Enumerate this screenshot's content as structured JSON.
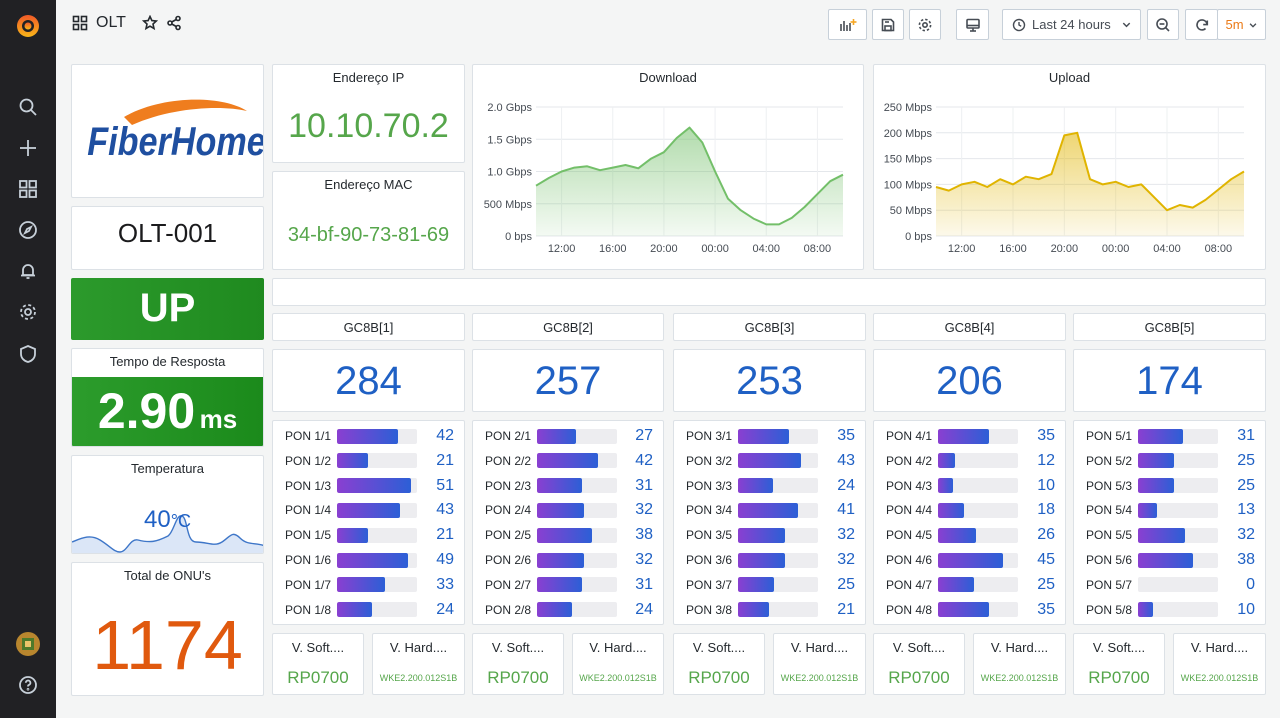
{
  "dashboard": {
    "title": "OLT"
  },
  "toolbar": {
    "time_range": "Last 24 hours",
    "refresh_interval": "5m"
  },
  "device": {
    "brand_logo_text": "FiberHome",
    "name": "OLT-001",
    "status": "UP",
    "ip_label": "Endereço IP",
    "ip": "10.10.70.2",
    "mac_label": "Endereço MAC",
    "mac": "34-bf-90-73-81-69",
    "response_label": "Tempo de Resposta",
    "response_value": "2.90",
    "response_unit": "ms",
    "temp_label": "Temperatura",
    "temp_value": "40",
    "temp_unit": "°C",
    "onu_label": "Total de ONU's",
    "onu_total": "1174"
  },
  "colors": {
    "up_green": "#299c29",
    "download_line": "#73bf69",
    "upload_line": "#e0b400",
    "onu_orange": "#e0590e",
    "value_blue": "#1f60c4"
  },
  "chart_data": [
    {
      "type": "area",
      "title": "Download",
      "x_ticks": [
        "12:00",
        "16:00",
        "20:00",
        "00:00",
        "04:00",
        "08:00"
      ],
      "y_ticks": [
        "0 bps",
        "500 Mbps",
        "1.0 Gbps",
        "1.5 Gbps",
        "2.0 Gbps"
      ],
      "ylim": [
        0,
        2000
      ],
      "unit": "Mbps",
      "x": [
        "10:00",
        "11:00",
        "12:00",
        "13:00",
        "14:00",
        "15:00",
        "16:00",
        "17:00",
        "18:00",
        "19:00",
        "20:00",
        "21:00",
        "22:00",
        "23:00",
        "00:00",
        "01:00",
        "02:00",
        "03:00",
        "04:00",
        "05:00",
        "06:00",
        "07:00",
        "08:00",
        "09:00",
        "10:00"
      ],
      "values": [
        780,
        900,
        1000,
        1060,
        1080,
        1020,
        1060,
        1100,
        1050,
        1200,
        1300,
        1520,
        1680,
        1450,
        1000,
        580,
        400,
        270,
        180,
        180,
        280,
        450,
        650,
        850,
        950
      ]
    },
    {
      "type": "area",
      "title": "Upload",
      "x_ticks": [
        "12:00",
        "16:00",
        "20:00",
        "00:00",
        "04:00",
        "08:00"
      ],
      "y_ticks": [
        "0 bps",
        "50 Mbps",
        "100 Mbps",
        "150 Mbps",
        "200 Mbps",
        "250 Mbps"
      ],
      "ylim": [
        0,
        250
      ],
      "unit": "Mbps",
      "x": [
        "10:00",
        "11:00",
        "12:00",
        "13:00",
        "14:00",
        "15:00",
        "16:00",
        "17:00",
        "18:00",
        "19:00",
        "20:00",
        "21:00",
        "22:00",
        "23:00",
        "00:00",
        "01:00",
        "02:00",
        "03:00",
        "04:00",
        "05:00",
        "06:00",
        "07:00",
        "08:00",
        "09:00",
        "10:00"
      ],
      "values": [
        95,
        88,
        100,
        105,
        95,
        110,
        100,
        115,
        110,
        120,
        195,
        200,
        110,
        100,
        105,
        95,
        100,
        75,
        50,
        60,
        55,
        70,
        90,
        110,
        125
      ]
    }
  ],
  "boards": [
    {
      "name": "GC8B[1]",
      "total": "284",
      "pons": [
        [
          "PON 1/1",
          42
        ],
        [
          "PON 1/2",
          21
        ],
        [
          "PON 1/3",
          51
        ],
        [
          "PON 1/4",
          43
        ],
        [
          "PON 1/5",
          21
        ],
        [
          "PON 1/6",
          49
        ],
        [
          "PON 1/7",
          33
        ],
        [
          "PON 1/8",
          24
        ]
      ],
      "soft_label": "V. Soft....",
      "soft": "RP0700",
      "hard_label": "V. Hard....",
      "hard": "WKE2.200.012S1B"
    },
    {
      "name": "GC8B[2]",
      "total": "257",
      "pons": [
        [
          "PON 2/1",
          27
        ],
        [
          "PON 2/2",
          42
        ],
        [
          "PON 2/3",
          31
        ],
        [
          "PON 2/4",
          32
        ],
        [
          "PON 2/5",
          38
        ],
        [
          "PON 2/6",
          32
        ],
        [
          "PON 2/7",
          31
        ],
        [
          "PON 2/8",
          24
        ]
      ],
      "soft_label": "V. Soft....",
      "soft": "RP0700",
      "hard_label": "V. Hard....",
      "hard": "WKE2.200.012S1B"
    },
    {
      "name": "GC8B[3]",
      "total": "253",
      "pons": [
        [
          "PON 3/1",
          35
        ],
        [
          "PON 3/2",
          43
        ],
        [
          "PON 3/3",
          24
        ],
        [
          "PON 3/4",
          41
        ],
        [
          "PON 3/5",
          32
        ],
        [
          "PON 3/6",
          32
        ],
        [
          "PON 3/7",
          25
        ],
        [
          "PON 3/8",
          21
        ]
      ],
      "soft_label": "V. Soft....",
      "soft": "RP0700",
      "hard_label": "V. Hard....",
      "hard": "WKE2.200.012S1B"
    },
    {
      "name": "GC8B[4]",
      "total": "206",
      "pons": [
        [
          "PON 4/1",
          35
        ],
        [
          "PON 4/2",
          12
        ],
        [
          "PON 4/3",
          10
        ],
        [
          "PON 4/4",
          18
        ],
        [
          "PON 4/5",
          26
        ],
        [
          "PON 4/6",
          45
        ],
        [
          "PON 4/7",
          25
        ],
        [
          "PON 4/8",
          35
        ]
      ],
      "soft_label": "V. Soft....",
      "soft": "RP0700",
      "hard_label": "V. Hard....",
      "hard": "WKE2.200.012S1B"
    },
    {
      "name": "GC8B[5]",
      "total": "174",
      "pons": [
        [
          "PON 5/1",
          31
        ],
        [
          "PON 5/2",
          25
        ],
        [
          "PON 5/3",
          25
        ],
        [
          "PON 5/4",
          13
        ],
        [
          "PON 5/5",
          32
        ],
        [
          "PON 5/6",
          38
        ],
        [
          "PON 5/7",
          0
        ],
        [
          "PON 5/8",
          10
        ]
      ],
      "soft_label": "V. Soft....",
      "soft": "RP0700",
      "hard_label": "V. Hard....",
      "hard": "WKE2.200.012S1B"
    }
  ],
  "pon_scale_max": 55,
  "icons": {
    "sidebar": [
      "grafana-logo-icon",
      "search-icon",
      "plus-icon",
      "dashboards-icon",
      "explore-icon",
      "bell-icon",
      "gear-icon",
      "shield-icon",
      "avatar-icon",
      "help-icon"
    ],
    "toolbar": [
      "add-panel-icon",
      "save-icon",
      "settings-icon",
      "tv-mode-icon",
      "clock-icon",
      "zoom-out-icon",
      "refresh-icon"
    ]
  }
}
